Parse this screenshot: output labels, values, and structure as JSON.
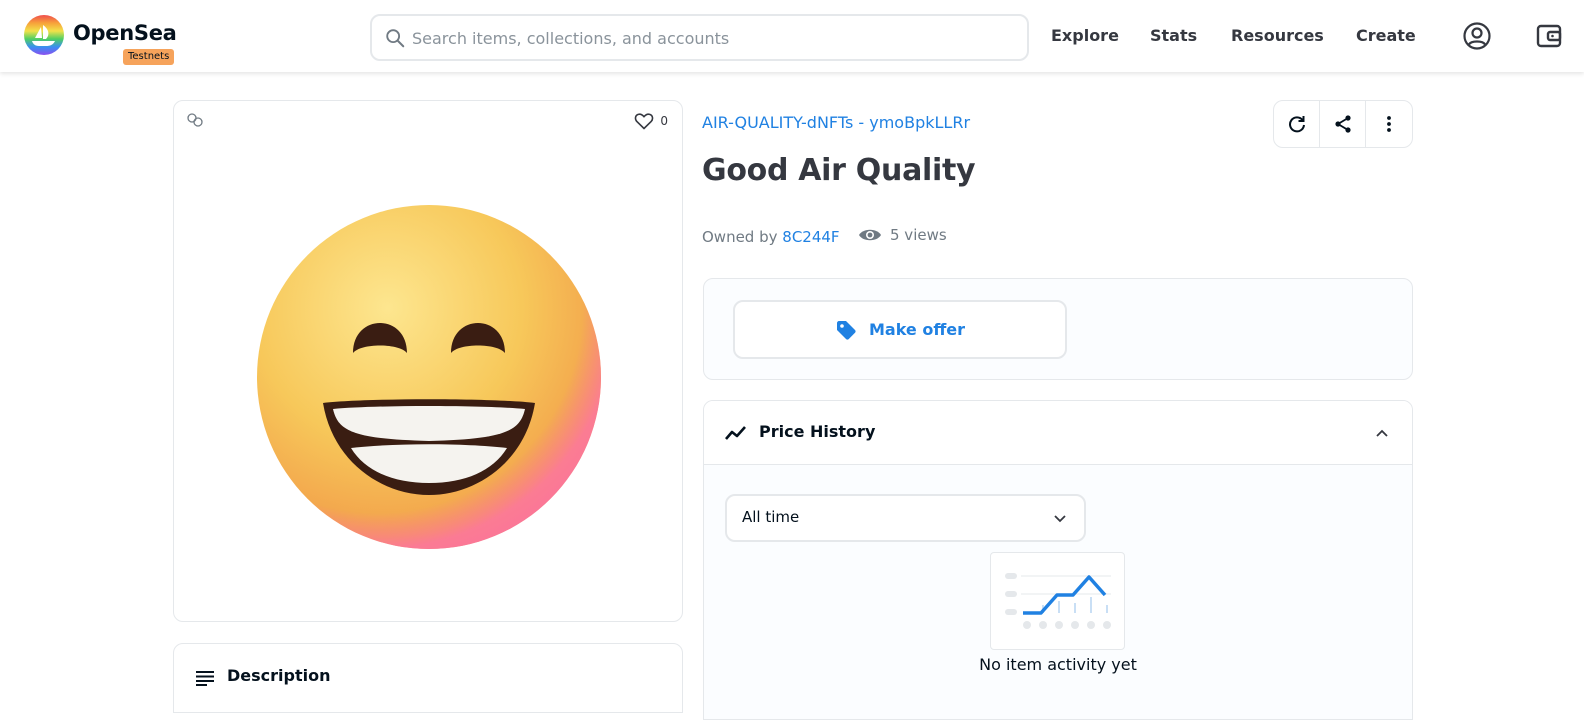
{
  "header": {
    "brand": "OpenSea",
    "badge": "Testnets",
    "search_placeholder": "Search items, collections, and accounts",
    "search_value": "",
    "nav": [
      "Explore",
      "Stats",
      "Resources",
      "Create"
    ],
    "icons": [
      "account-icon",
      "wallet-icon"
    ]
  },
  "item": {
    "favorites_count": "0",
    "collection": "AIR-QUALITY-dNFTs - ymoBpkLLRr",
    "title": "Good Air Quality",
    "owned_by_label": "Owned by",
    "owner": "8C244F",
    "views": "5 views",
    "description_label": "Description"
  },
  "offer": {
    "button_label": "Make offer"
  },
  "price_history": {
    "label": "Price History",
    "time_range": "All time",
    "empty_text": "No item activity yet"
  },
  "colors": {
    "accent": "#2081e2",
    "badge": "#f6a35b",
    "border": "#e5e8eb",
    "text_dark": "#353840",
    "text_muted": "#707a83"
  }
}
